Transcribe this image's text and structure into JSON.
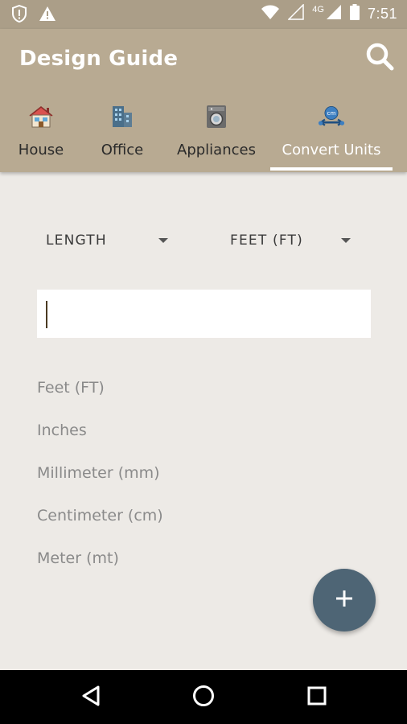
{
  "status_bar": {
    "time": "7:51",
    "network": "4G"
  },
  "app": {
    "title": "Design Guide"
  },
  "tabs": [
    {
      "label": "House",
      "icon": "house-icon"
    },
    {
      "label": "Office",
      "icon": "office-building-icon"
    },
    {
      "label": "Appliances",
      "icon": "washing-machine-icon"
    },
    {
      "label": "Convert Units",
      "icon": "convert-units-icon",
      "active": true
    }
  ],
  "converter": {
    "category": "LENGTH",
    "from_unit": "FEET (FT)",
    "input_value": "",
    "results": [
      "Feet (FT)",
      "Inches",
      "Millimeter (mm)",
      "Centimeter (cm)",
      "Meter (mt)"
    ]
  },
  "colors": {
    "appbar": "#b8aa92",
    "status_bar": "#ab9e88",
    "background": "#edeae6",
    "fab": "#4e6575",
    "active_tab": "#ffffff"
  }
}
